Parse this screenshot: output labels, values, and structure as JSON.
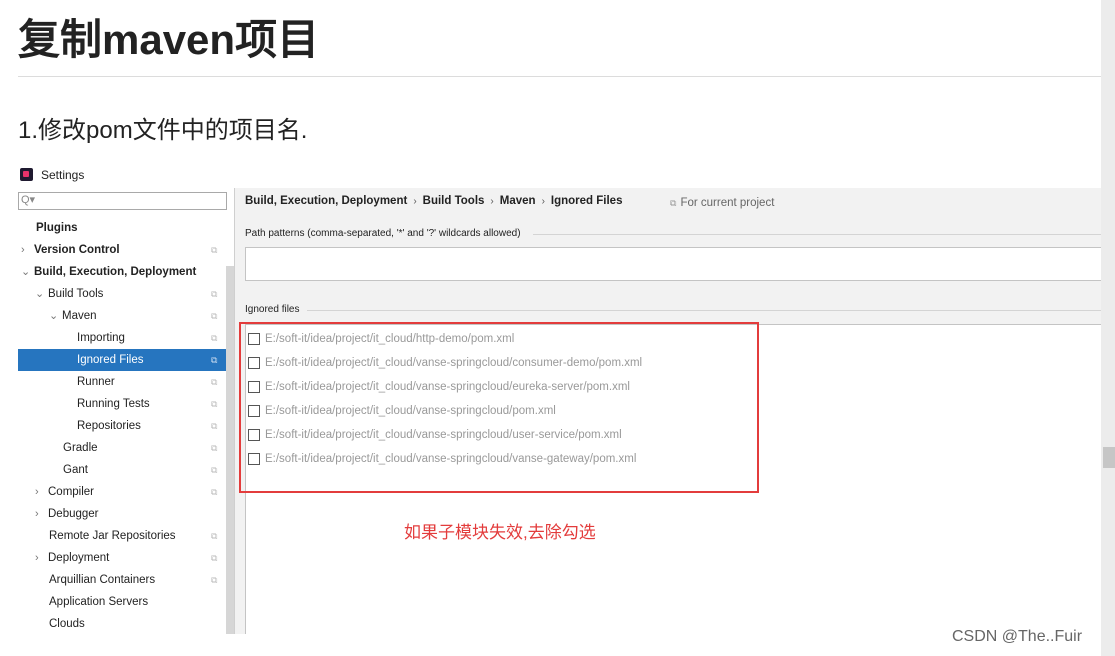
{
  "article": {
    "title": "复制maven项目",
    "subtitle": "1.修改pom文件中的项目名."
  },
  "window": {
    "title": "Settings"
  },
  "search": {
    "placeholder": "",
    "icon": "search-icon"
  },
  "sidebar": {
    "items": [
      {
        "label": "Plugins",
        "bold": true,
        "chevron": "",
        "copy": false
      },
      {
        "label": "Version Control",
        "bold": true,
        "chevron": "›",
        "copy": true
      },
      {
        "label": "Build, Execution, Deployment",
        "bold": true,
        "chevron": "⌄",
        "copy": false
      },
      {
        "label": "Build Tools",
        "bold": false,
        "chevron": "⌄",
        "copy": true
      },
      {
        "label": "Maven",
        "bold": false,
        "chevron": "⌄",
        "copy": true
      },
      {
        "label": "Importing",
        "bold": false,
        "chevron": "",
        "copy": true
      },
      {
        "label": "Ignored Files",
        "bold": false,
        "chevron": "",
        "copy": true,
        "selected": true
      },
      {
        "label": "Runner",
        "bold": false,
        "chevron": "",
        "copy": true
      },
      {
        "label": "Running Tests",
        "bold": false,
        "chevron": "",
        "copy": true
      },
      {
        "label": "Repositories",
        "bold": false,
        "chevron": "",
        "copy": true
      },
      {
        "label": "Gradle",
        "bold": false,
        "chevron": "",
        "copy": true
      },
      {
        "label": "Gant",
        "bold": false,
        "chevron": "",
        "copy": true
      },
      {
        "label": "Compiler",
        "bold": false,
        "chevron": "›",
        "copy": true
      },
      {
        "label": "Debugger",
        "bold": false,
        "chevron": "›",
        "copy": false
      },
      {
        "label": "Remote Jar Repositories",
        "bold": false,
        "chevron": "",
        "copy": true
      },
      {
        "label": "Deployment",
        "bold": false,
        "chevron": "›",
        "copy": true
      },
      {
        "label": "Arquillian Containers",
        "bold": false,
        "chevron": "",
        "copy": true
      },
      {
        "label": "Application Servers",
        "bold": false,
        "chevron": "",
        "copy": false
      },
      {
        "label": "Clouds",
        "bold": false,
        "chevron": "",
        "copy": false
      }
    ]
  },
  "breadcrumb": [
    "Build, Execution, Deployment",
    "Build Tools",
    "Maven",
    "Ignored Files"
  ],
  "breadcrumb_separator": "›",
  "scope": {
    "label": "For current project",
    "icon": "copy-icon"
  },
  "path_patterns": {
    "label": "Path patterns (comma-separated, '*' and '?' wildcards allowed)",
    "value": ""
  },
  "ignored_files": {
    "label": "Ignored files",
    "items": [
      {
        "path": "E:/soft-it/idea/project/it_cloud/http-demo/pom.xml",
        "checked": false
      },
      {
        "path": "E:/soft-it/idea/project/it_cloud/vanse-springcloud/consumer-demo/pom.xml",
        "checked": false
      },
      {
        "path": "E:/soft-it/idea/project/it_cloud/vanse-springcloud/eureka-server/pom.xml",
        "checked": false
      },
      {
        "path": "E:/soft-it/idea/project/it_cloud/vanse-springcloud/pom.xml",
        "checked": false
      },
      {
        "path": "E:/soft-it/idea/project/it_cloud/vanse-springcloud/user-service/pom.xml",
        "checked": false
      },
      {
        "path": "E:/soft-it/idea/project/it_cloud/vanse-springcloud/vanse-gateway/pom.xml",
        "checked": false
      }
    ]
  },
  "annotation": "如果子模块失效,去除勾选",
  "watermark": "CSDN @The..Fuir",
  "colors": {
    "selection": "#2675bf",
    "annotation": "#e33c3c"
  }
}
